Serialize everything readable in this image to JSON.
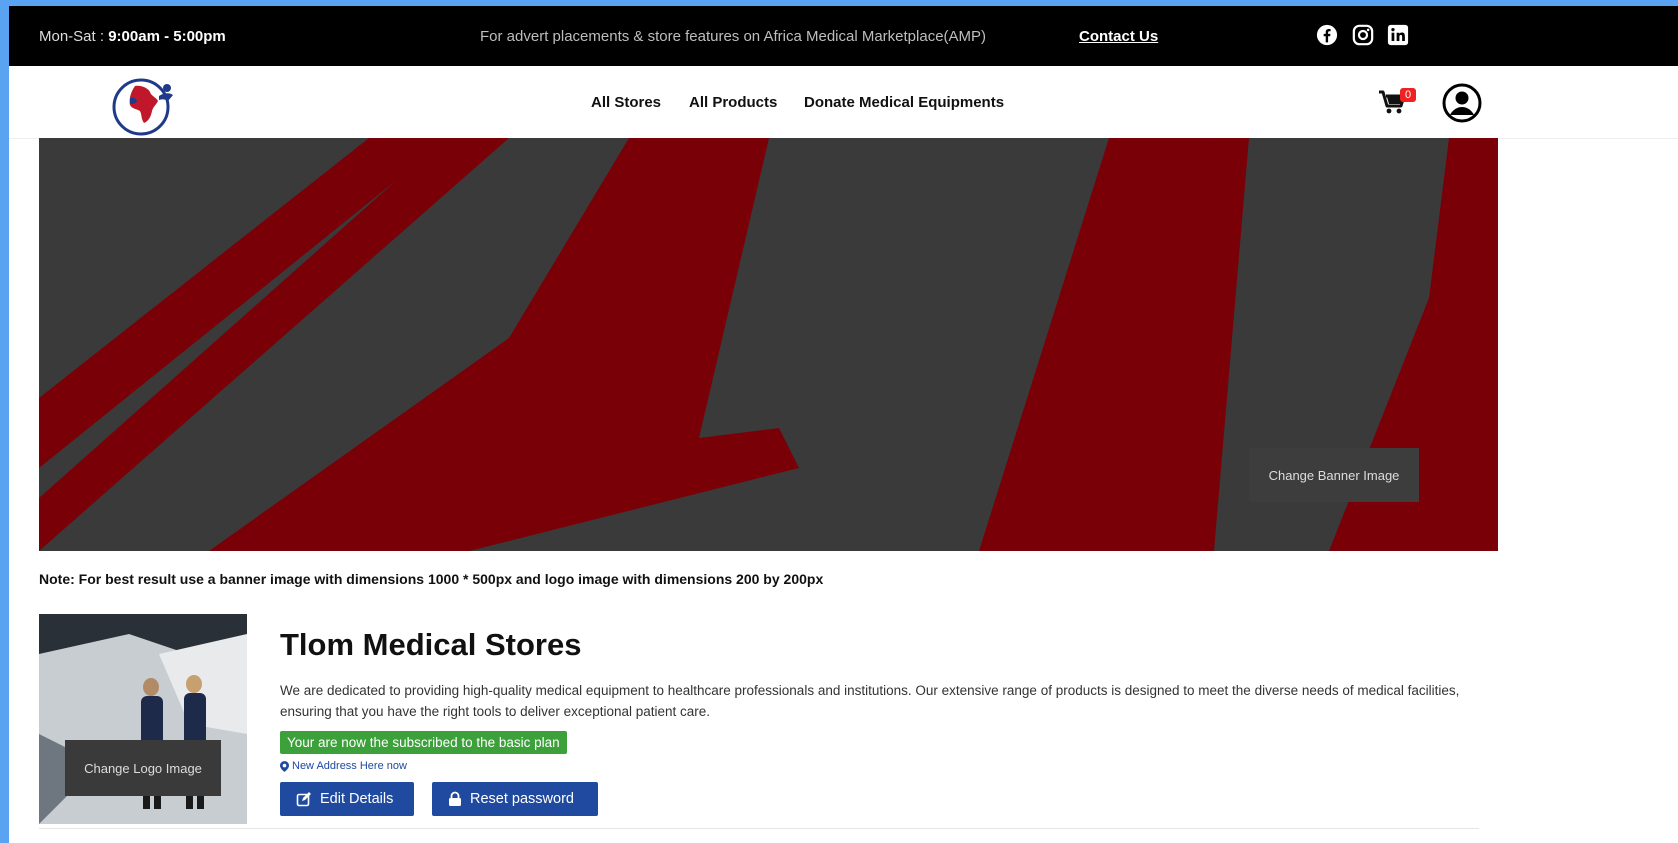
{
  "topbar": {
    "hours_label": "Mon-Sat : ",
    "hours_value": "9:00am - 5:00pm",
    "advert_text": "For advert placements & store features on Africa Medical Marketplace(AMP)",
    "contact_label": "Contact Us",
    "social_icons": [
      "facebook-icon",
      "instagram-icon",
      "linkedin-icon"
    ]
  },
  "nav": {
    "links": [
      "All Stores",
      "All Products",
      "Donate Medical Equipments"
    ],
    "cart_count": "0"
  },
  "banner": {
    "change_label": "Change Banner Image"
  },
  "note": "Note: For best result use a banner image with dimensions 1000 * 500px and logo image with dimensions 200 by 200px",
  "store": {
    "change_logo_label": "Change Logo Image",
    "name": "Tlom Medical Stores",
    "description": "We are dedicated to providing high-quality medical equipment to healthcare professionals and institutions. Our extensive range of products is designed to meet the diverse needs of medical facilities, ensuring that you have the right tools to deliver exceptional patient care.",
    "plan_status": "Your are now the subscribed to the basic plan",
    "address": "New Address Here now",
    "edit_label": "Edit Details",
    "reset_label": "Reset password"
  },
  "colors": {
    "banner_red": "#7a0008",
    "banner_dark": "#3a3a3a",
    "primary_button": "#1f4aa0",
    "plan_green": "#3ca13a",
    "badge_red": "#e22222"
  }
}
